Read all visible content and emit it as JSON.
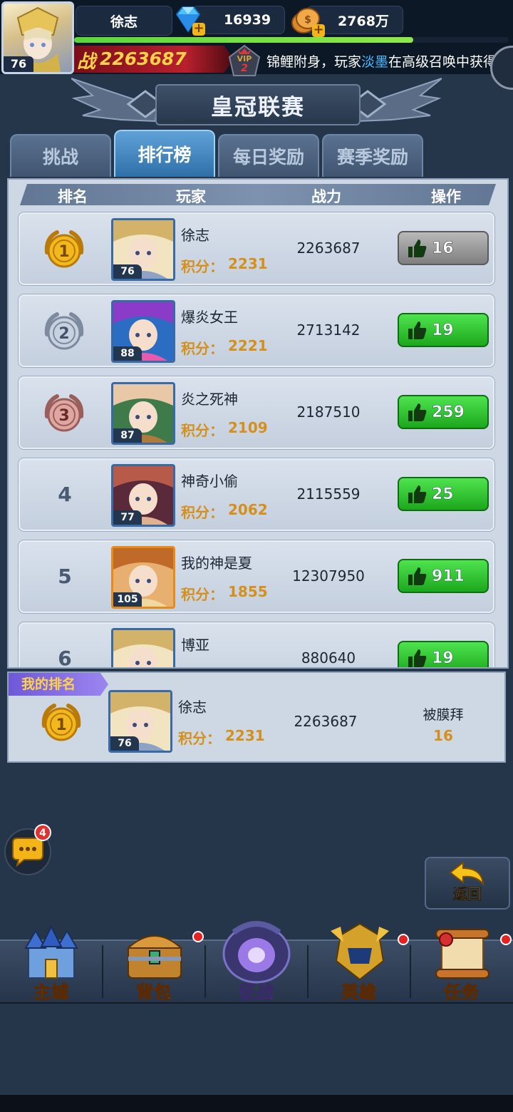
{
  "top": {
    "avatar_level": "76",
    "player_name": "徐志",
    "diamonds": "16939",
    "gold": "2768万",
    "exp_ratio": 0.78,
    "power_prefix": "战",
    "power_value": "2263687",
    "vip_label": "VIP",
    "vip_level": "2",
    "marquee_pre": "锦鲤附身，玩家",
    "marquee_name": "淡墨",
    "marquee_post": "在高级召唤中获得"
  },
  "title": "皇冠联赛",
  "tabs": [
    {
      "label": "挑战"
    },
    {
      "label": "排行榜"
    },
    {
      "label": "每日奖励"
    },
    {
      "label": "赛季奖励"
    }
  ],
  "headers": {
    "rank": "排名",
    "player": "玩家",
    "power": "战力",
    "action": "操作"
  },
  "score_label": "积分：",
  "rows": [
    {
      "rank": "1",
      "level": "76",
      "name": "徐志",
      "score": "2231",
      "power": "2263687",
      "likes": "16"
    },
    {
      "rank": "2",
      "level": "88",
      "name": "爆炎女王",
      "score": "2221",
      "power": "2713142",
      "likes": "19"
    },
    {
      "rank": "3",
      "level": "87",
      "name": "炎之死神",
      "score": "2109",
      "power": "2187510",
      "likes": "259"
    },
    {
      "rank": "4",
      "level": "77",
      "name": "神奇小偷",
      "score": "2062",
      "power": "2115559",
      "likes": "25"
    },
    {
      "rank": "5",
      "level": "105",
      "name": "我的神是夏",
      "score": "1855",
      "power": "12307950",
      "likes": "911"
    },
    {
      "rank": "6",
      "level": "",
      "name": "博亚",
      "score": "",
      "power": "880640",
      "likes": "19"
    }
  ],
  "my_rank": {
    "tag": "我的排名",
    "rank": "1",
    "level": "76",
    "name": "徐志",
    "score": "2231",
    "power": "2263687",
    "worship_label": "被膜拜",
    "worship_count": "16"
  },
  "chat_badge": "4",
  "back_label": "返回",
  "nav": [
    {
      "label": "主城"
    },
    {
      "label": "背包"
    },
    {
      "label": "征战"
    },
    {
      "label": "英雄"
    },
    {
      "label": "任务"
    }
  ],
  "colors": {
    "accent_gold": "#ffd24a",
    "score": "#d4901a",
    "like_green": "#2dc52d",
    "tab_active": "#2e6fa8"
  }
}
